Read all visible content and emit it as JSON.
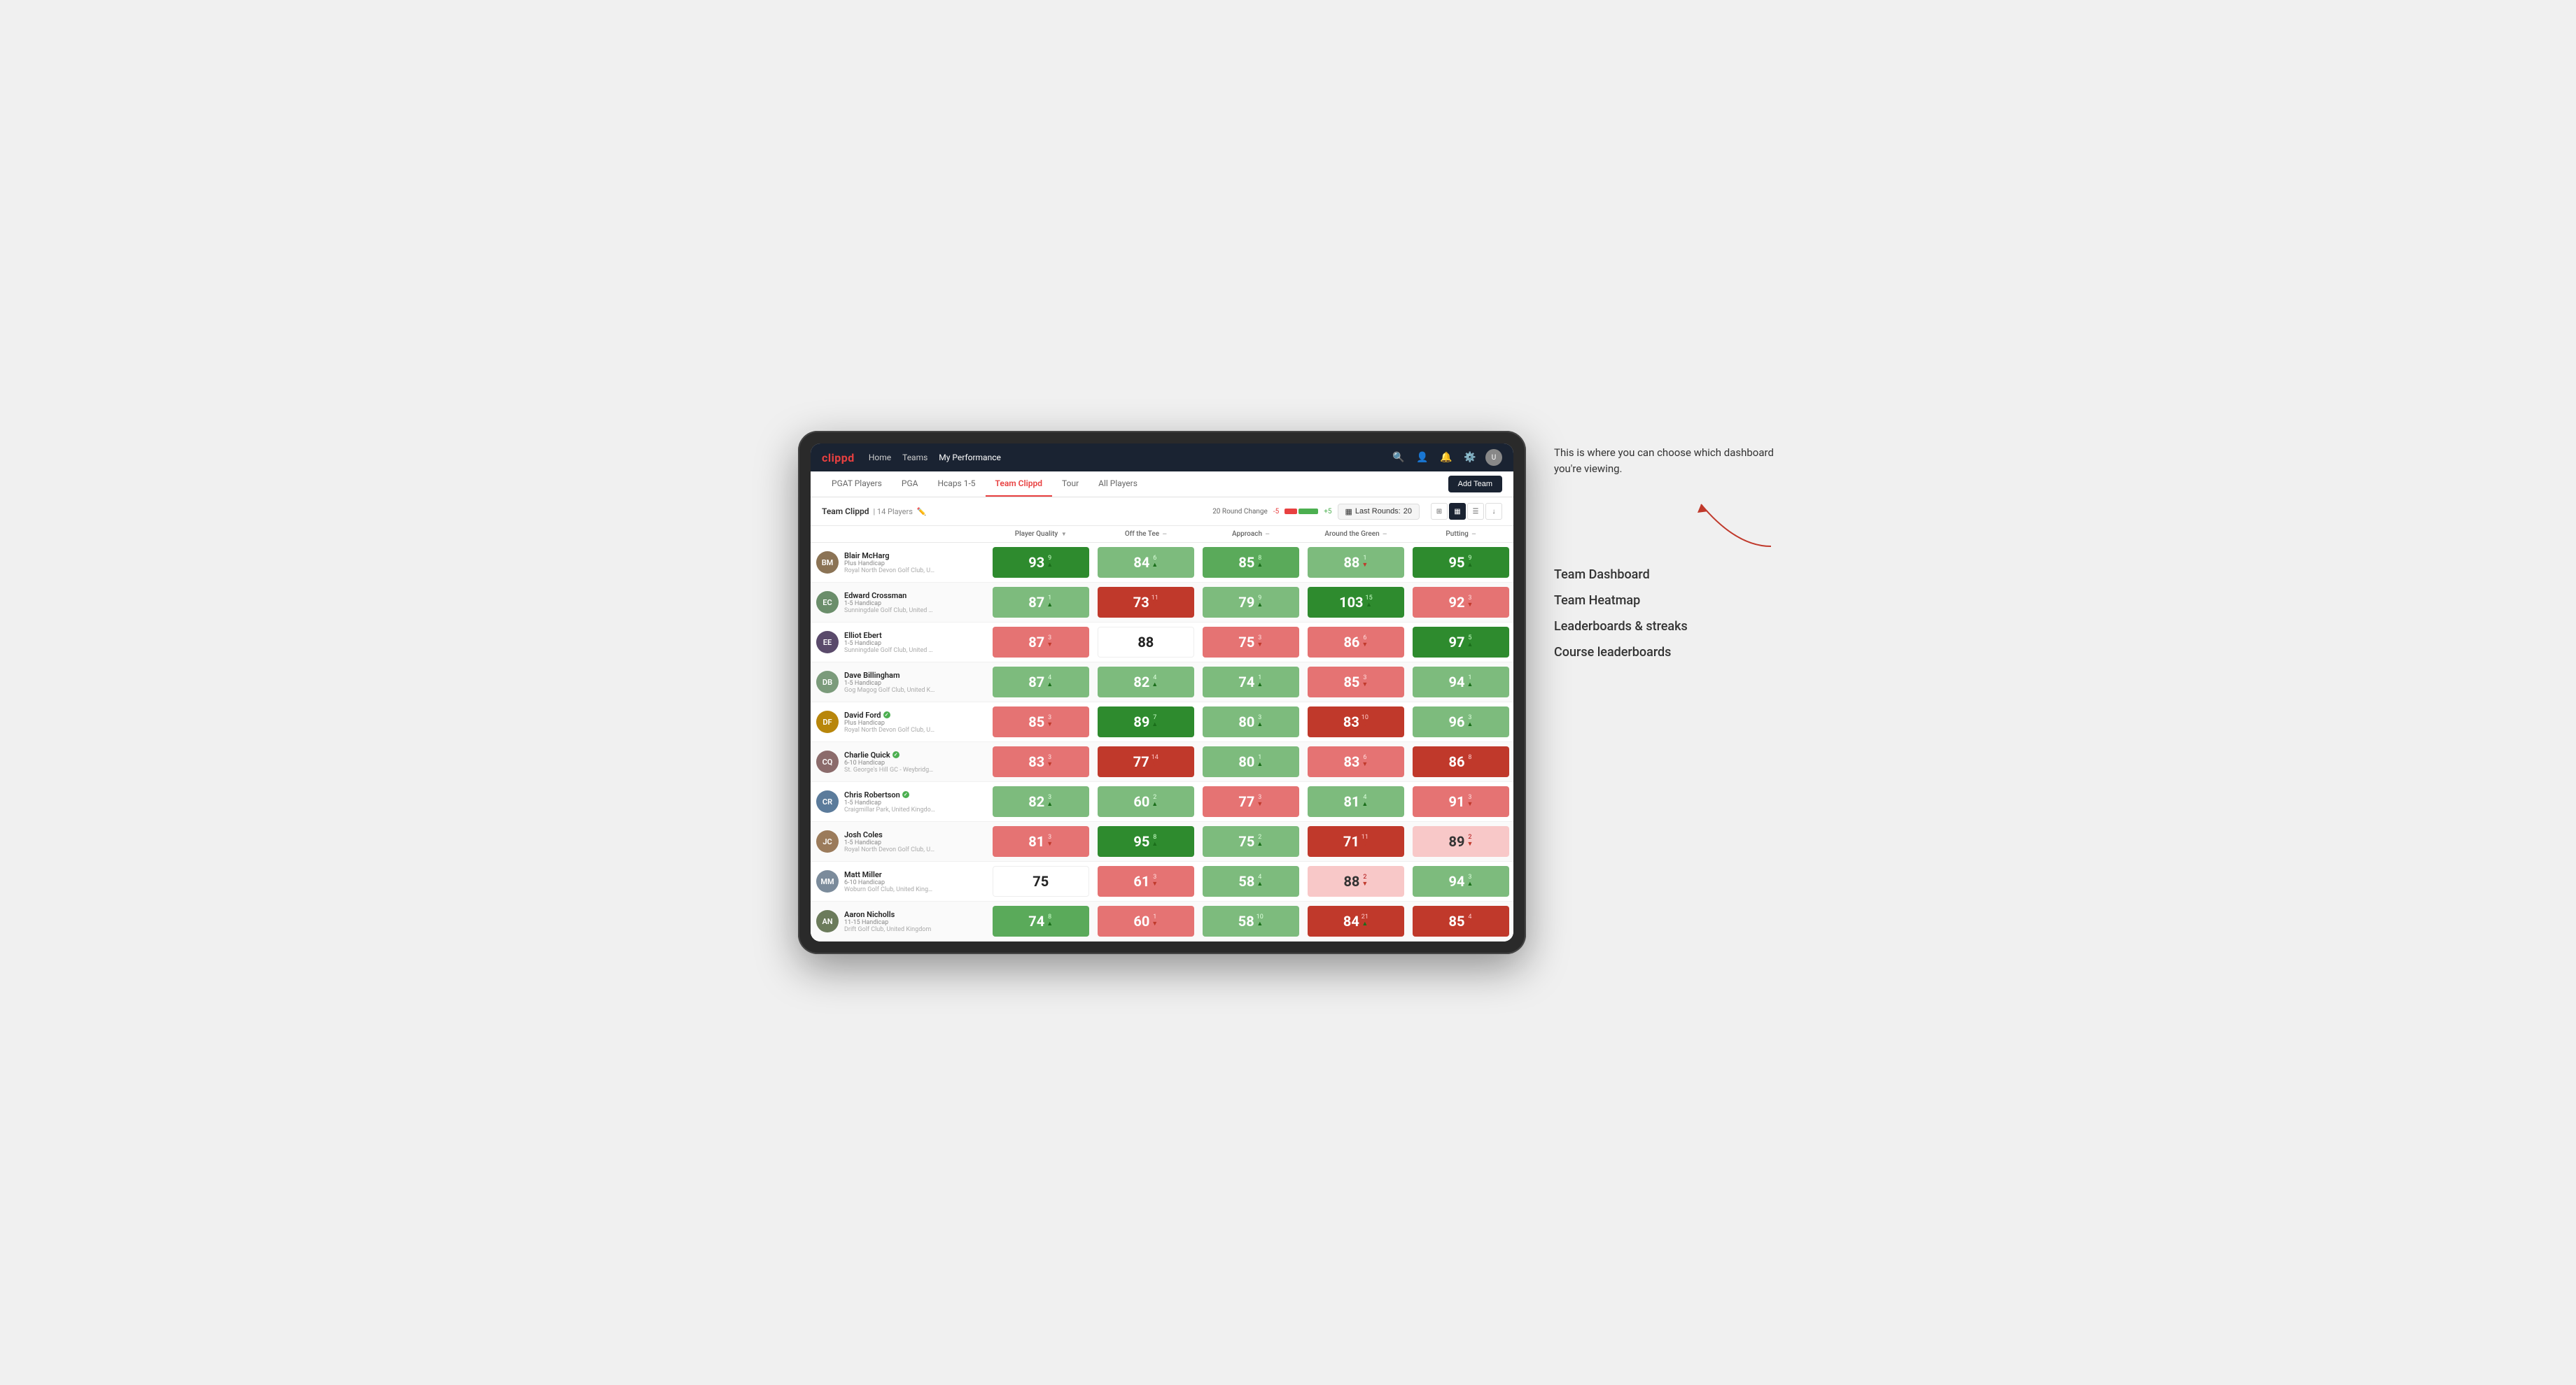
{
  "annotation": {
    "description": "This is where you can choose which dashboard you're viewing.",
    "options": [
      "Team Dashboard",
      "Team Heatmap",
      "Leaderboards & streaks",
      "Course leaderboards"
    ]
  },
  "navbar": {
    "logo": "clippd",
    "links": [
      "Home",
      "Teams",
      "My Performance"
    ],
    "active_link": "My Performance"
  },
  "subnav": {
    "tabs": [
      "PGAT Players",
      "PGA",
      "Hcaps 1-5",
      "Team Clippd",
      "Tour",
      "All Players"
    ],
    "active_tab": "Team Clippd",
    "add_team_label": "Add Team"
  },
  "team_header": {
    "name": "Team Clippd",
    "separator": "|",
    "count": "14 Players",
    "round_change_label": "20 Round Change",
    "change_minus": "-5",
    "change_plus": "+5",
    "last_rounds_label": "Last Rounds:",
    "last_rounds_value": "20"
  },
  "table": {
    "columns": [
      "Player Quality",
      "Off the Tee",
      "Approach",
      "Around the Green",
      "Putting"
    ],
    "rows": [
      {
        "name": "Blair McHarg",
        "handicap": "Plus Handicap",
        "club": "Royal North Devon Golf Club, United Kingdom",
        "avatar_color": "#8B7355",
        "initials": "BM",
        "scores": [
          {
            "value": "93",
            "change": "9",
            "dir": "up",
            "color": "green-dark"
          },
          {
            "value": "84",
            "change": "6",
            "dir": "up",
            "color": "green-light"
          },
          {
            "value": "85",
            "change": "8",
            "dir": "up",
            "color": "green-mid"
          },
          {
            "value": "88",
            "change": "1",
            "dir": "down",
            "color": "green-light"
          },
          {
            "value": "95",
            "change": "9",
            "dir": "up",
            "color": "green-dark"
          }
        ]
      },
      {
        "name": "Edward Crossman",
        "handicap": "1-5 Handicap",
        "club": "Sunningdale Golf Club, United Kingdom",
        "avatar_color": "#6B8E6B",
        "initials": "EC",
        "scores": [
          {
            "value": "87",
            "change": "1",
            "dir": "up",
            "color": "green-light"
          },
          {
            "value": "73",
            "change": "11",
            "dir": "down",
            "color": "red-dark"
          },
          {
            "value": "79",
            "change": "9",
            "dir": "up",
            "color": "green-light"
          },
          {
            "value": "103",
            "change": "15",
            "dir": "up",
            "color": "green-dark"
          },
          {
            "value": "92",
            "change": "3",
            "dir": "down",
            "color": "red-light"
          }
        ]
      },
      {
        "name": "Elliot Ebert",
        "handicap": "1-5 Handicap",
        "club": "Sunningdale Golf Club, United Kingdom",
        "avatar_color": "#5a4a6b",
        "initials": "EE",
        "scores": [
          {
            "value": "87",
            "change": "3",
            "dir": "down",
            "color": "red-light"
          },
          {
            "value": "88",
            "change": "",
            "dir": "none",
            "color": "white"
          },
          {
            "value": "75",
            "change": "3",
            "dir": "down",
            "color": "red-light"
          },
          {
            "value": "86",
            "change": "6",
            "dir": "down",
            "color": "red-light"
          },
          {
            "value": "97",
            "change": "5",
            "dir": "up",
            "color": "green-dark"
          }
        ]
      },
      {
        "name": "Dave Billingham",
        "handicap": "1-5 Handicap",
        "club": "Gog Magog Golf Club, United Kingdom",
        "avatar_color": "#7B9B7B",
        "initials": "DB",
        "scores": [
          {
            "value": "87",
            "change": "4",
            "dir": "up",
            "color": "green-light"
          },
          {
            "value": "82",
            "change": "4",
            "dir": "up",
            "color": "green-light"
          },
          {
            "value": "74",
            "change": "1",
            "dir": "up",
            "color": "green-light"
          },
          {
            "value": "85",
            "change": "3",
            "dir": "down",
            "color": "red-light"
          },
          {
            "value": "94",
            "change": "1",
            "dir": "up",
            "color": "green-light"
          }
        ]
      },
      {
        "name": "David Ford",
        "handicap": "Plus Handicap",
        "club": "Royal North Devon Golf Club, United Kingdom",
        "avatar_color": "#B8860B",
        "initials": "DF",
        "verified": true,
        "scores": [
          {
            "value": "85",
            "change": "3",
            "dir": "down",
            "color": "red-light"
          },
          {
            "value": "89",
            "change": "7",
            "dir": "up",
            "color": "green-dark"
          },
          {
            "value": "80",
            "change": "3",
            "dir": "up",
            "color": "green-light"
          },
          {
            "value": "83",
            "change": "10",
            "dir": "down",
            "color": "red-dark"
          },
          {
            "value": "96",
            "change": "3",
            "dir": "up",
            "color": "green-light"
          }
        ]
      },
      {
        "name": "Charlie Quick",
        "handicap": "6-10 Handicap",
        "club": "St. George's Hill GC - Weybridge, Surrey, Uni...",
        "avatar_color": "#8B6B6B",
        "initials": "CQ",
        "verified": true,
        "scores": [
          {
            "value": "83",
            "change": "3",
            "dir": "down",
            "color": "red-light"
          },
          {
            "value": "77",
            "change": "14",
            "dir": "down",
            "color": "red-dark"
          },
          {
            "value": "80",
            "change": "1",
            "dir": "up",
            "color": "green-light"
          },
          {
            "value": "83",
            "change": "6",
            "dir": "down",
            "color": "red-light"
          },
          {
            "value": "86",
            "change": "8",
            "dir": "down",
            "color": "red-dark"
          }
        ]
      },
      {
        "name": "Chris Robertson",
        "handicap": "1-5 Handicap",
        "club": "Craigmillar Park, United Kingdom",
        "avatar_color": "#5B7B9B",
        "initials": "CR",
        "verified": true,
        "scores": [
          {
            "value": "82",
            "change": "3",
            "dir": "up",
            "color": "green-light"
          },
          {
            "value": "60",
            "change": "2",
            "dir": "up",
            "color": "green-light"
          },
          {
            "value": "77",
            "change": "3",
            "dir": "down",
            "color": "red-light"
          },
          {
            "value": "81",
            "change": "4",
            "dir": "up",
            "color": "green-light"
          },
          {
            "value": "91",
            "change": "3",
            "dir": "down",
            "color": "red-light"
          }
        ]
      },
      {
        "name": "Josh Coles",
        "handicap": "1-5 Handicap",
        "club": "Royal North Devon Golf Club, United Kingdom",
        "avatar_color": "#9B7B5B",
        "initials": "JC",
        "scores": [
          {
            "value": "81",
            "change": "3",
            "dir": "down",
            "color": "red-light"
          },
          {
            "value": "95",
            "change": "8",
            "dir": "up",
            "color": "green-dark"
          },
          {
            "value": "75",
            "change": "2",
            "dir": "up",
            "color": "green-light"
          },
          {
            "value": "71",
            "change": "11",
            "dir": "down",
            "color": "red-dark"
          },
          {
            "value": "89",
            "change": "2",
            "dir": "down",
            "color": "pink-light"
          }
        ]
      },
      {
        "name": "Matt Miller",
        "handicap": "6-10 Handicap",
        "club": "Woburn Golf Club, United Kingdom",
        "avatar_color": "#7B8B9B",
        "initials": "MM",
        "scores": [
          {
            "value": "75",
            "change": "",
            "dir": "none",
            "color": "white"
          },
          {
            "value": "61",
            "change": "3",
            "dir": "down",
            "color": "red-light"
          },
          {
            "value": "58",
            "change": "4",
            "dir": "up",
            "color": "green-light"
          },
          {
            "value": "88",
            "change": "2",
            "dir": "down",
            "color": "pink-light"
          },
          {
            "value": "94",
            "change": "3",
            "dir": "up",
            "color": "green-light"
          }
        ]
      },
      {
        "name": "Aaron Nicholls",
        "handicap": "11-15 Handicap",
        "club": "Drift Golf Club, United Kingdom",
        "avatar_color": "#6B7B5B",
        "initials": "AN",
        "scores": [
          {
            "value": "74",
            "change": "8",
            "dir": "up",
            "color": "green-mid"
          },
          {
            "value": "60",
            "change": "1",
            "dir": "down",
            "color": "red-light"
          },
          {
            "value": "58",
            "change": "10",
            "dir": "up",
            "color": "green-light"
          },
          {
            "value": "84",
            "change": "21",
            "dir": "up",
            "color": "red-dark"
          },
          {
            "value": "85",
            "change": "4",
            "dir": "down",
            "color": "red-dark"
          }
        ]
      }
    ]
  }
}
